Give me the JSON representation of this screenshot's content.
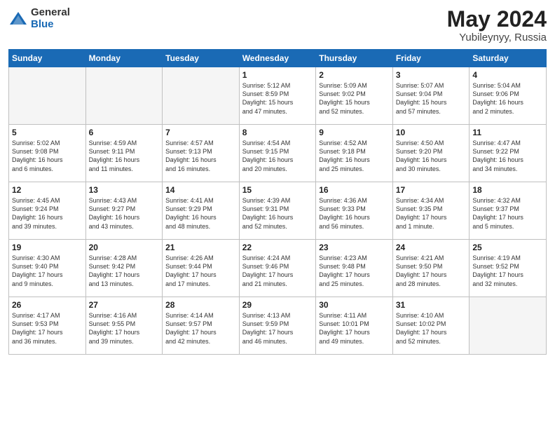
{
  "logo": {
    "general": "General",
    "blue": "Blue"
  },
  "title": {
    "month_year": "May 2024",
    "location": "Yubileynyy, Russia"
  },
  "weekdays": [
    "Sunday",
    "Monday",
    "Tuesday",
    "Wednesday",
    "Thursday",
    "Friday",
    "Saturday"
  ],
  "weeks": [
    [
      {
        "day": "",
        "lines": []
      },
      {
        "day": "",
        "lines": []
      },
      {
        "day": "",
        "lines": []
      },
      {
        "day": "1",
        "lines": [
          "Sunrise: 5:12 AM",
          "Sunset: 8:59 PM",
          "Daylight: 15 hours",
          "and 47 minutes."
        ]
      },
      {
        "day": "2",
        "lines": [
          "Sunrise: 5:09 AM",
          "Sunset: 9:02 PM",
          "Daylight: 15 hours",
          "and 52 minutes."
        ]
      },
      {
        "day": "3",
        "lines": [
          "Sunrise: 5:07 AM",
          "Sunset: 9:04 PM",
          "Daylight: 15 hours",
          "and 57 minutes."
        ]
      },
      {
        "day": "4",
        "lines": [
          "Sunrise: 5:04 AM",
          "Sunset: 9:06 PM",
          "Daylight: 16 hours",
          "and 2 minutes."
        ]
      }
    ],
    [
      {
        "day": "5",
        "lines": [
          "Sunrise: 5:02 AM",
          "Sunset: 9:08 PM",
          "Daylight: 16 hours",
          "and 6 minutes."
        ]
      },
      {
        "day": "6",
        "lines": [
          "Sunrise: 4:59 AM",
          "Sunset: 9:11 PM",
          "Daylight: 16 hours",
          "and 11 minutes."
        ]
      },
      {
        "day": "7",
        "lines": [
          "Sunrise: 4:57 AM",
          "Sunset: 9:13 PM",
          "Daylight: 16 hours",
          "and 16 minutes."
        ]
      },
      {
        "day": "8",
        "lines": [
          "Sunrise: 4:54 AM",
          "Sunset: 9:15 PM",
          "Daylight: 16 hours",
          "and 20 minutes."
        ]
      },
      {
        "day": "9",
        "lines": [
          "Sunrise: 4:52 AM",
          "Sunset: 9:18 PM",
          "Daylight: 16 hours",
          "and 25 minutes."
        ]
      },
      {
        "day": "10",
        "lines": [
          "Sunrise: 4:50 AM",
          "Sunset: 9:20 PM",
          "Daylight: 16 hours",
          "and 30 minutes."
        ]
      },
      {
        "day": "11",
        "lines": [
          "Sunrise: 4:47 AM",
          "Sunset: 9:22 PM",
          "Daylight: 16 hours",
          "and 34 minutes."
        ]
      }
    ],
    [
      {
        "day": "12",
        "lines": [
          "Sunrise: 4:45 AM",
          "Sunset: 9:24 PM",
          "Daylight: 16 hours",
          "and 39 minutes."
        ]
      },
      {
        "day": "13",
        "lines": [
          "Sunrise: 4:43 AM",
          "Sunset: 9:27 PM",
          "Daylight: 16 hours",
          "and 43 minutes."
        ]
      },
      {
        "day": "14",
        "lines": [
          "Sunrise: 4:41 AM",
          "Sunset: 9:29 PM",
          "Daylight: 16 hours",
          "and 48 minutes."
        ]
      },
      {
        "day": "15",
        "lines": [
          "Sunrise: 4:39 AM",
          "Sunset: 9:31 PM",
          "Daylight: 16 hours",
          "and 52 minutes."
        ]
      },
      {
        "day": "16",
        "lines": [
          "Sunrise: 4:36 AM",
          "Sunset: 9:33 PM",
          "Daylight: 16 hours",
          "and 56 minutes."
        ]
      },
      {
        "day": "17",
        "lines": [
          "Sunrise: 4:34 AM",
          "Sunset: 9:35 PM",
          "Daylight: 17 hours",
          "and 1 minute."
        ]
      },
      {
        "day": "18",
        "lines": [
          "Sunrise: 4:32 AM",
          "Sunset: 9:37 PM",
          "Daylight: 17 hours",
          "and 5 minutes."
        ]
      }
    ],
    [
      {
        "day": "19",
        "lines": [
          "Sunrise: 4:30 AM",
          "Sunset: 9:40 PM",
          "Daylight: 17 hours",
          "and 9 minutes."
        ]
      },
      {
        "day": "20",
        "lines": [
          "Sunrise: 4:28 AM",
          "Sunset: 9:42 PM",
          "Daylight: 17 hours",
          "and 13 minutes."
        ]
      },
      {
        "day": "21",
        "lines": [
          "Sunrise: 4:26 AM",
          "Sunset: 9:44 PM",
          "Daylight: 17 hours",
          "and 17 minutes."
        ]
      },
      {
        "day": "22",
        "lines": [
          "Sunrise: 4:24 AM",
          "Sunset: 9:46 PM",
          "Daylight: 17 hours",
          "and 21 minutes."
        ]
      },
      {
        "day": "23",
        "lines": [
          "Sunrise: 4:23 AM",
          "Sunset: 9:48 PM",
          "Daylight: 17 hours",
          "and 25 minutes."
        ]
      },
      {
        "day": "24",
        "lines": [
          "Sunrise: 4:21 AM",
          "Sunset: 9:50 PM",
          "Daylight: 17 hours",
          "and 28 minutes."
        ]
      },
      {
        "day": "25",
        "lines": [
          "Sunrise: 4:19 AM",
          "Sunset: 9:52 PM",
          "Daylight: 17 hours",
          "and 32 minutes."
        ]
      }
    ],
    [
      {
        "day": "26",
        "lines": [
          "Sunrise: 4:17 AM",
          "Sunset: 9:53 PM",
          "Daylight: 17 hours",
          "and 36 minutes."
        ]
      },
      {
        "day": "27",
        "lines": [
          "Sunrise: 4:16 AM",
          "Sunset: 9:55 PM",
          "Daylight: 17 hours",
          "and 39 minutes."
        ]
      },
      {
        "day": "28",
        "lines": [
          "Sunrise: 4:14 AM",
          "Sunset: 9:57 PM",
          "Daylight: 17 hours",
          "and 42 minutes."
        ]
      },
      {
        "day": "29",
        "lines": [
          "Sunrise: 4:13 AM",
          "Sunset: 9:59 PM",
          "Daylight: 17 hours",
          "and 46 minutes."
        ]
      },
      {
        "day": "30",
        "lines": [
          "Sunrise: 4:11 AM",
          "Sunset: 10:01 PM",
          "Daylight: 17 hours",
          "and 49 minutes."
        ]
      },
      {
        "day": "31",
        "lines": [
          "Sunrise: 4:10 AM",
          "Sunset: 10:02 PM",
          "Daylight: 17 hours",
          "and 52 minutes."
        ]
      },
      {
        "day": "",
        "lines": []
      }
    ]
  ]
}
